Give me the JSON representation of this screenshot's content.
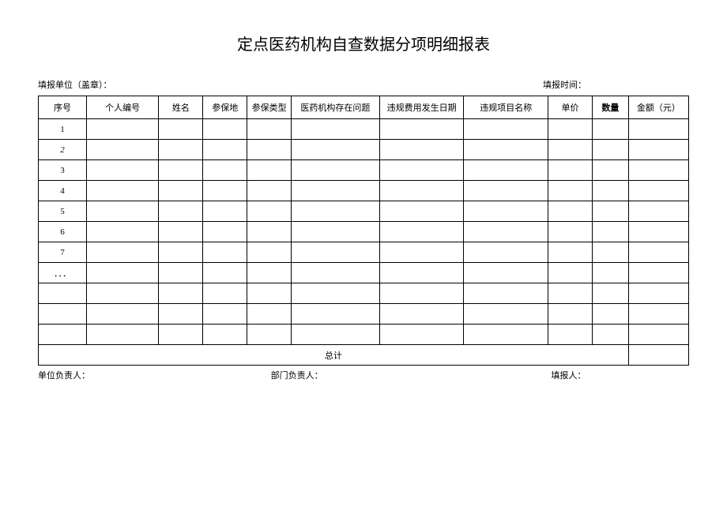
{
  "title": "定点医药机构自查数据分项明细报表",
  "meta": {
    "unit_label": "填报单位（盖章）：",
    "time_label": "填报时间："
  },
  "headers": {
    "seq": "序号",
    "pid": "个人编号",
    "name": "姓名",
    "loc": "参保地",
    "type": "参保类型",
    "issue": "医药机构存在问题",
    "date": "违规费用发生日期",
    "item": "违规项目名称",
    "price": "单价",
    "qty": "数量",
    "amt": "金额（元）"
  },
  "rows": [
    {
      "seq": "1"
    },
    {
      "seq": "2"
    },
    {
      "seq": "3"
    },
    {
      "seq": "4"
    },
    {
      "seq": "5"
    },
    {
      "seq": "6"
    },
    {
      "seq": "7"
    },
    {
      "seq": "．．．"
    },
    {
      "seq": ""
    },
    {
      "seq": ""
    },
    {
      "seq": ""
    }
  ],
  "total_label": "总计",
  "footer": {
    "unit_leader": "单位负责人：",
    "dept_leader": "部门负责人：",
    "reporter": "填报人："
  }
}
